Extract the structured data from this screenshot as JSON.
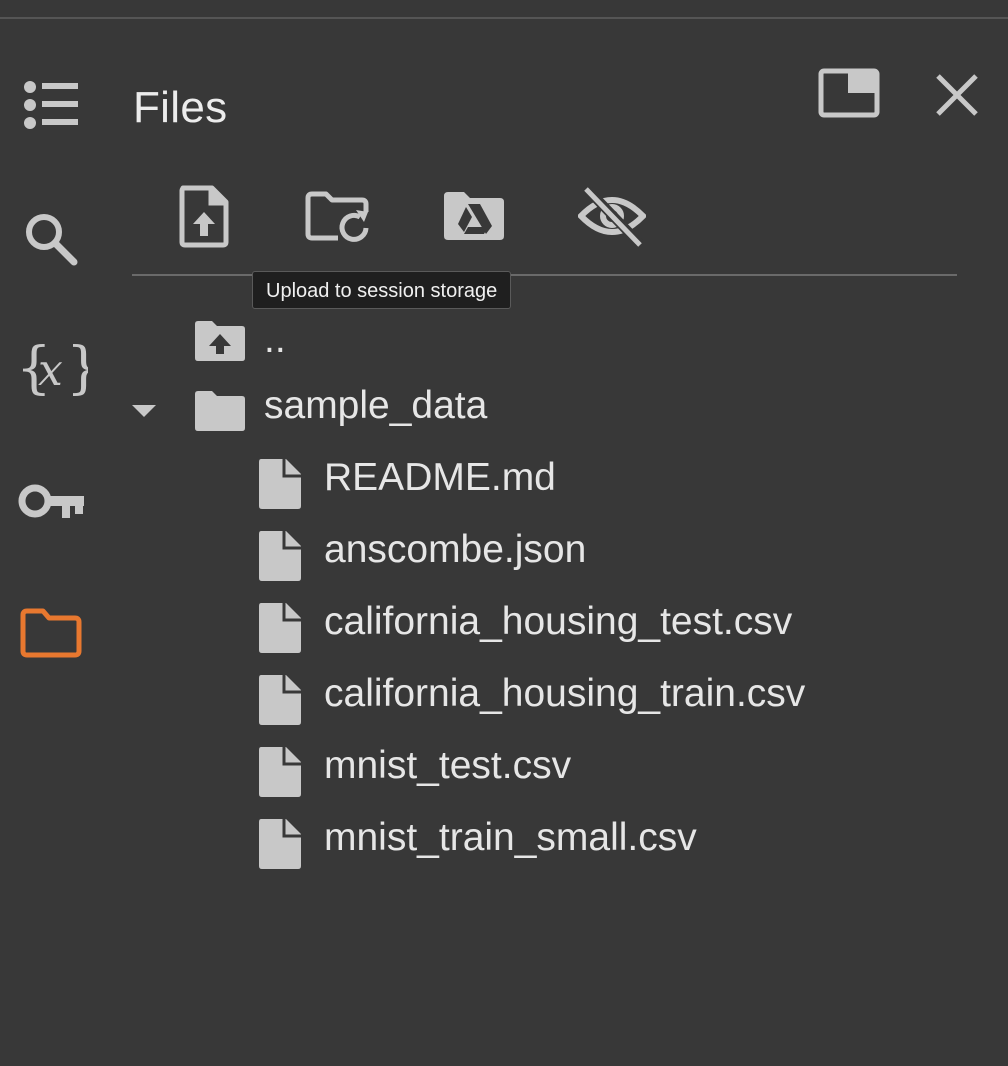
{
  "panel": {
    "title": "Files"
  },
  "rail": {
    "items": [
      {
        "name": "table-of-contents",
        "icon": "list-icon"
      },
      {
        "name": "find-and-replace",
        "icon": "search-icon"
      },
      {
        "name": "variables",
        "icon": "variables-icon"
      },
      {
        "name": "secrets",
        "icon": "key-icon"
      },
      {
        "name": "files",
        "icon": "folder-icon",
        "active": true
      }
    ]
  },
  "header": {
    "buttons": [
      {
        "icon": "open-in-tab-icon"
      },
      {
        "icon": "close-icon"
      }
    ]
  },
  "toolbar": {
    "buttons": [
      {
        "icon": "upload-file-icon"
      },
      {
        "icon": "refresh-folder-icon"
      },
      {
        "icon": "mount-drive-icon"
      },
      {
        "icon": "hidden-files-icon"
      }
    ],
    "tooltip": "Upload to session storage"
  },
  "tree": {
    "parent_label": "..",
    "folder": {
      "name": "sample_data",
      "expanded": true,
      "files": [
        "README.md",
        "anscombe.json",
        "california_housing_test.csv",
        "california_housing_train.csv",
        "mnist_test.csv",
        "mnist_train_small.csv"
      ]
    }
  },
  "colors": {
    "background": "#383838",
    "icon": "#c8c8c8",
    "active": "#e8782f",
    "text": "#e6e6e6"
  }
}
